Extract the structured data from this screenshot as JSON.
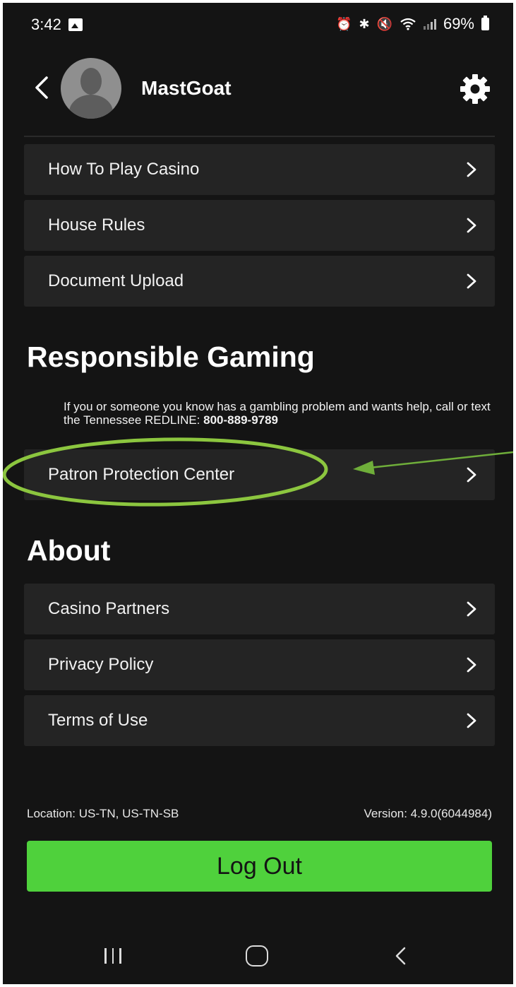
{
  "status_bar": {
    "time": "3:42",
    "battery": "69%",
    "icons": [
      "gallery-icon",
      "alarm-icon",
      "bluetooth-icon",
      "mute-icon",
      "wifi-icon",
      "signal-icon",
      "battery-icon"
    ]
  },
  "header": {
    "username": "MastGoat",
    "icons": [
      "back-icon",
      "avatar",
      "gear-icon"
    ]
  },
  "menu_top": [
    {
      "label": "How To Play Casino"
    },
    {
      "label": "House Rules"
    },
    {
      "label": "Document Upload"
    }
  ],
  "responsible_gaming": {
    "title": "Responsible Gaming",
    "text": "If you or someone you know has a gambling problem and wants help, call or text the Tennessee REDLINE: ",
    "phone": "800-889-9789",
    "items": [
      {
        "label": "Patron Protection Center"
      }
    ]
  },
  "about": {
    "title": "About",
    "items": [
      {
        "label": "Casino Partners"
      },
      {
        "label": "Privacy Policy"
      },
      {
        "label": "Terms of Use"
      }
    ]
  },
  "footer": {
    "location": "Location: US-TN, US-TN-SB",
    "version": "Version: 4.9.0(6044984)",
    "logout_label": "Log Out"
  },
  "colors": {
    "background": "#141414",
    "row": "#242424",
    "accent_green": "#4fd13c",
    "annotation_green": "#8cc63f"
  }
}
